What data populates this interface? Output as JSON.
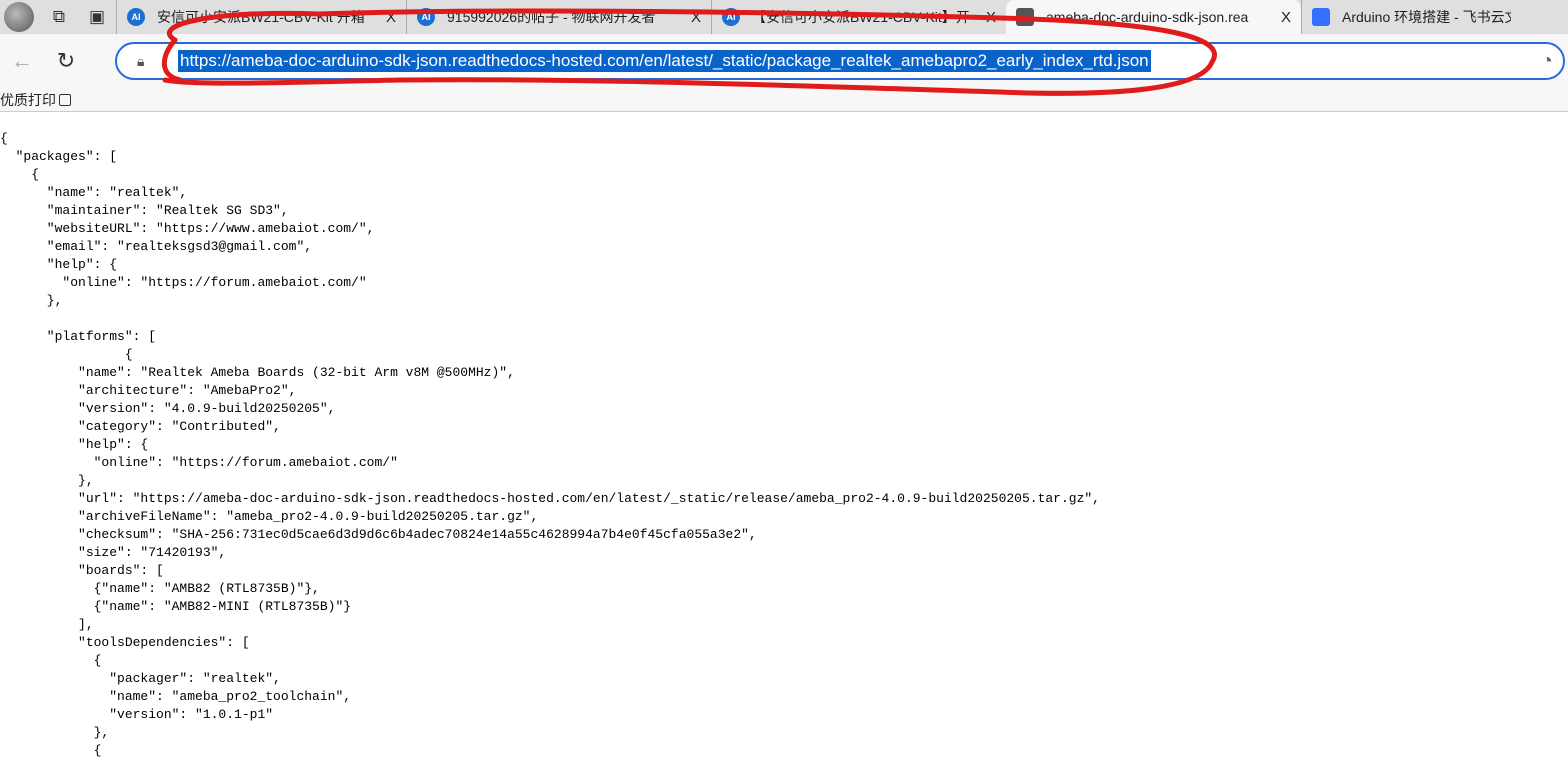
{
  "tabs": [
    {
      "icon": "ai-icon",
      "title": "安信可小安派BW21-CBV-Kit 开箱"
    },
    {
      "icon": "ai-icon",
      "title": "915992026的帖子 - 物联网开发者"
    },
    {
      "icon": "ai-icon",
      "title": "【安信可小安派BW21-CBV-Kit】开"
    },
    {
      "icon": "doc-icon",
      "title": "ameba-doc-arduino-sdk-json.rea",
      "active": true
    },
    {
      "icon": "feishu-doc-icon",
      "title": "Arduino 环境搭建 - 飞书云文"
    }
  ],
  "fav_text": "AI",
  "close_glyph": "X",
  "address": {
    "url": "https://ameba-doc-arduino-sdk-json.readthedocs-hosted.com/en/latest/_static/package_realtek_amebapro2_early_index_rtd.json"
  },
  "print_bar": {
    "label": "优质打印"
  },
  "annotation_color": "#e01b1b",
  "selection_color": "#0a63c9",
  "json_lines": [
    "{",
    "  \"packages\": [",
    "    {",
    "      \"name\": \"realtek\",",
    "      \"maintainer\": \"Realtek SG SD3\",",
    "      \"websiteURL\": \"https://www.amebaiot.com/\",",
    "      \"email\": \"realteksgsd3@gmail.com\",",
    "      \"help\": {",
    "        \"online\": \"https://forum.amebaiot.com/\"",
    "      },",
    "",
    "      \"platforms\": [",
    "                {",
    "          \"name\": \"Realtek Ameba Boards (32-bit Arm v8M @500MHz)\",",
    "          \"architecture\": \"AmebaPro2\",",
    "          \"version\": \"4.0.9-build20250205\",",
    "          \"category\": \"Contributed\",",
    "          \"help\": {",
    "            \"online\": \"https://forum.amebaiot.com/\"",
    "          },",
    "          \"url\": \"https://ameba-doc-arduino-sdk-json.readthedocs-hosted.com/en/latest/_static/release/ameba_pro2-4.0.9-build20250205.tar.gz\",",
    "          \"archiveFileName\": \"ameba_pro2-4.0.9-build20250205.tar.gz\",",
    "          \"checksum\": \"SHA-256:731ec0d5cae6d3d9d6c6b4adec70824e14a55c4628994a7b4e0f45cfa055a3e2\",",
    "          \"size\": \"71420193\",",
    "          \"boards\": [",
    "            {\"name\": \"AMB82 (RTL8735B)\"},",
    "            {\"name\": \"AMB82-MINI (RTL8735B)\"}",
    "          ],",
    "          \"toolsDependencies\": [",
    "            {",
    "              \"packager\": \"realtek\",",
    "              \"name\": \"ameba_pro2_toolchain\",",
    "              \"version\": \"1.0.1-p1\"",
    "            },",
    "            {"
  ]
}
